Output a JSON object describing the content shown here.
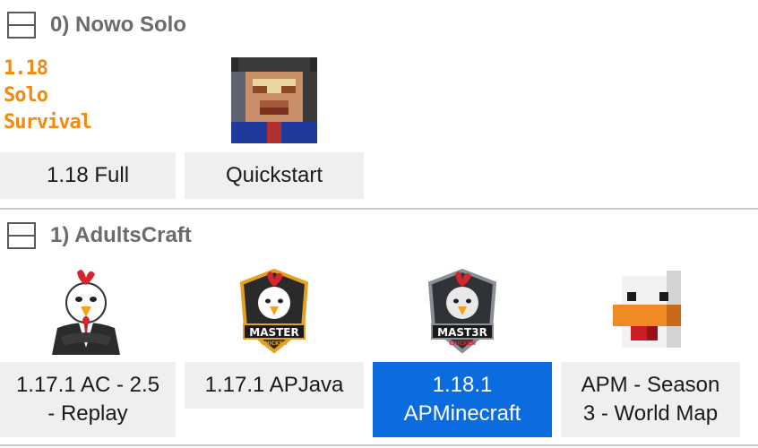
{
  "groups": [
    {
      "title": "0) Nowo Solo",
      "toggle_icon": "collapse-toggle-icon",
      "instances": [
        {
          "label": "1.18 Full",
          "art_text": "1.18 Solo\nSurvival",
          "icon": "solo-survival-text-logo",
          "selected": false
        },
        {
          "label": "Quickstart",
          "icon": "pixel-face-avatar",
          "selected": false
        }
      ]
    },
    {
      "title": "1) AdultsCraft",
      "toggle_icon": "collapse-toggle-icon",
      "instances": [
        {
          "label": "1.17.1 AC - 2.5\n- Replay",
          "icon": "rooster-suit-mascot",
          "selected": false
        },
        {
          "label": "1.17.1 APJava",
          "icon": "master-chicken-badge",
          "badge_text": "MASTER",
          "badge_sub": "CHICKEN",
          "selected": false
        },
        {
          "label": "1.18.1\nAPMinecraft",
          "icon": "master-chicken-badge-dark",
          "badge_text": "MAST3R",
          "badge_sub": "CHICKEN",
          "selected": true
        },
        {
          "label": "APM - Season\n3 - World Map",
          "icon": "pixel-duck-head",
          "selected": false
        }
      ]
    }
  ],
  "colors": {
    "selected": "#0a6cdf",
    "tile_bg": "#efefef",
    "header_text": "#6b6b6b",
    "orange": "#f28a10"
  }
}
